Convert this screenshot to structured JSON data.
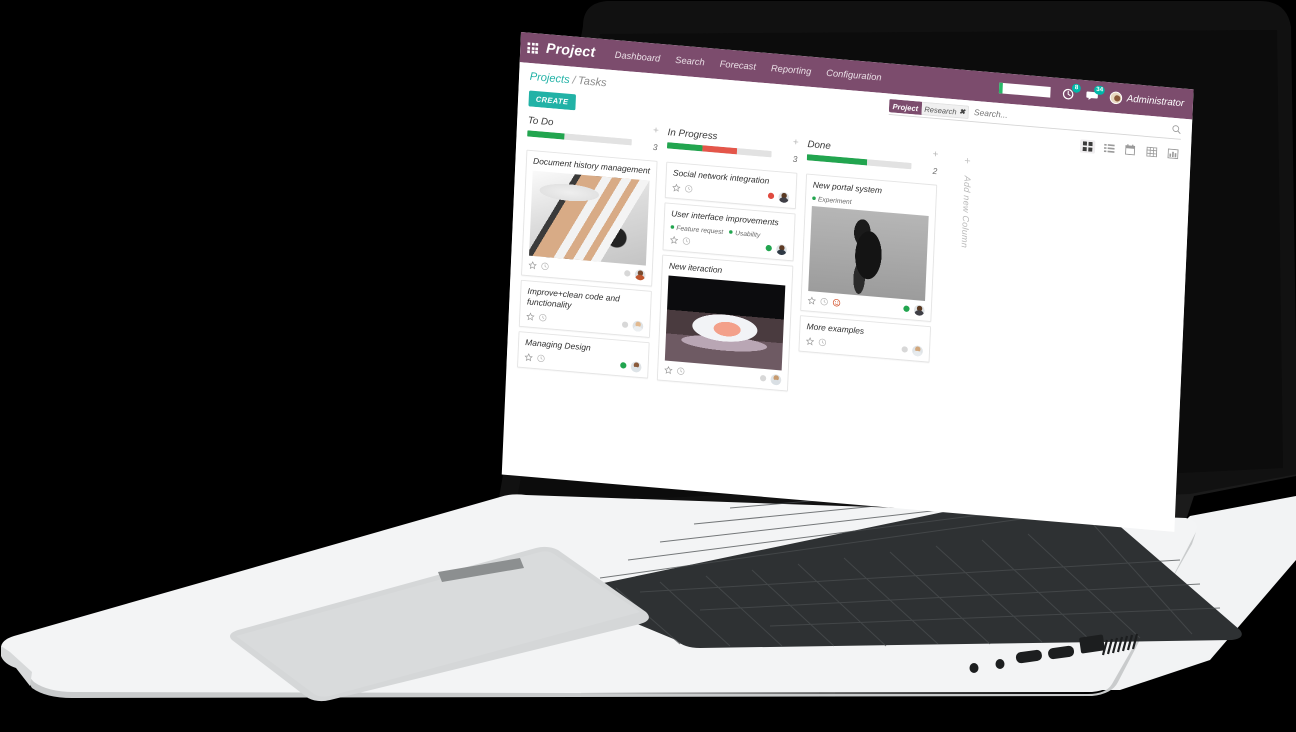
{
  "navbar": {
    "apps_icon": "apps-grid-icon",
    "brand": "Project",
    "links": [
      "Dashboard",
      "Search",
      "Forecast",
      "Reporting",
      "Configuration"
    ],
    "activity_icon": "activity-clock-icon",
    "activity_badge": "8",
    "messages_icon": "messages-bubble-icon",
    "messages_badge": "34",
    "user_name": "Administrator",
    "brand_color": "#7c4c6d",
    "badge_color": "#00b8a9"
  },
  "control_panel": {
    "breadcrumb_root": "Projects",
    "breadcrumb_sep": "/",
    "breadcrumb_current": "Tasks",
    "create_label": "CREATE",
    "accent_color": "#21b2a6",
    "search": {
      "facet_key": "Project",
      "facet_value": "Research",
      "facet_remove": "✖",
      "placeholder": "Search...",
      "value": "",
      "search_icon": "magnifier-icon"
    },
    "views": [
      {
        "name": "kanban",
        "icon": "kanban-grid-icon",
        "active": true
      },
      {
        "name": "list",
        "icon": "list-icon",
        "active": false
      },
      {
        "name": "calendar",
        "icon": "calendar-icon",
        "active": false
      },
      {
        "name": "pivot",
        "icon": "pivot-table-icon",
        "active": false
      },
      {
        "name": "graph",
        "icon": "bar-chart-icon",
        "active": false
      }
    ]
  },
  "kanban": {
    "add_column_plus": "+",
    "add_column_label": "Add new Column",
    "columns": [
      {
        "title": "To Do",
        "count": "3",
        "plus": "+",
        "progress": [
          {
            "color": "#22a54f",
            "pct": 36
          },
          {
            "color": "#e2e2e2",
            "pct": 64
          }
        ],
        "cards": [
          {
            "title": "Document history management",
            "tags": [],
            "image": "makeup-brushes-photo",
            "art": "art-brushes",
            "star_icon": "star-outline-icon",
            "clock_icon": "clock-outline-icon",
            "dot": "gray",
            "avatar": "a1"
          },
          {
            "title": "Improve+clean code and functionality",
            "tags": [],
            "image": null,
            "art": null,
            "star_icon": "star-outline-icon",
            "clock_icon": "clock-outline-icon",
            "dot": "gray",
            "avatar": "a3"
          },
          {
            "title": "Managing Design",
            "tags": [],
            "image": null,
            "art": null,
            "star_icon": "star-outline-icon",
            "clock_icon": "clock-outline-icon",
            "dot": "green",
            "avatar": "a4"
          }
        ]
      },
      {
        "title": "In Progress",
        "count": "3",
        "plus": "+",
        "progress": [
          {
            "color": "#22a54f",
            "pct": 34
          },
          {
            "color": "#e4564a",
            "pct": 33
          },
          {
            "color": "#e2e2e2",
            "pct": 33
          }
        ],
        "cards": [
          {
            "title": "Social network integration",
            "tags": [],
            "image": null,
            "art": null,
            "star_icon": "star-outline-icon",
            "clock_icon": "clock-outline-icon",
            "dot": "red",
            "avatar": "a2"
          },
          {
            "title": "User interface improvements",
            "tags": [
              "Feature request",
              "Usability"
            ],
            "image": null,
            "art": null,
            "star_icon": "star-outline-icon",
            "clock_icon": "clock-outline-icon",
            "dot": "green",
            "avatar": "a6"
          },
          {
            "title": "New iteraction",
            "tags": [],
            "image": "sneaker-photo",
            "art": "art-shoe",
            "star_icon": "star-outline-icon",
            "clock_icon": "clock-outline-icon",
            "dot": "gray",
            "avatar": "a5"
          }
        ]
      },
      {
        "title": "Done",
        "count": "2",
        "plus": "+",
        "progress": [
          {
            "color": "#22a54f",
            "pct": 58
          },
          {
            "color": "#e2e2e2",
            "pct": 42
          }
        ],
        "cards": [
          {
            "title": "New portal system",
            "tags": [
              "Experiment"
            ],
            "image": "fashion-outfit-photo",
            "art": "art-fashion",
            "star_icon": "star-outline-icon",
            "clock_icon": "clock-outline-icon",
            "smile_icon": "smiley-face-icon",
            "dot": "green",
            "avatar": "a2"
          },
          {
            "title": "More examples",
            "tags": [],
            "image": null,
            "art": null,
            "star_icon": "star-outline-icon",
            "clock_icon": "clock-outline-icon",
            "dot": "gray",
            "avatar": "a7"
          }
        ]
      }
    ]
  }
}
